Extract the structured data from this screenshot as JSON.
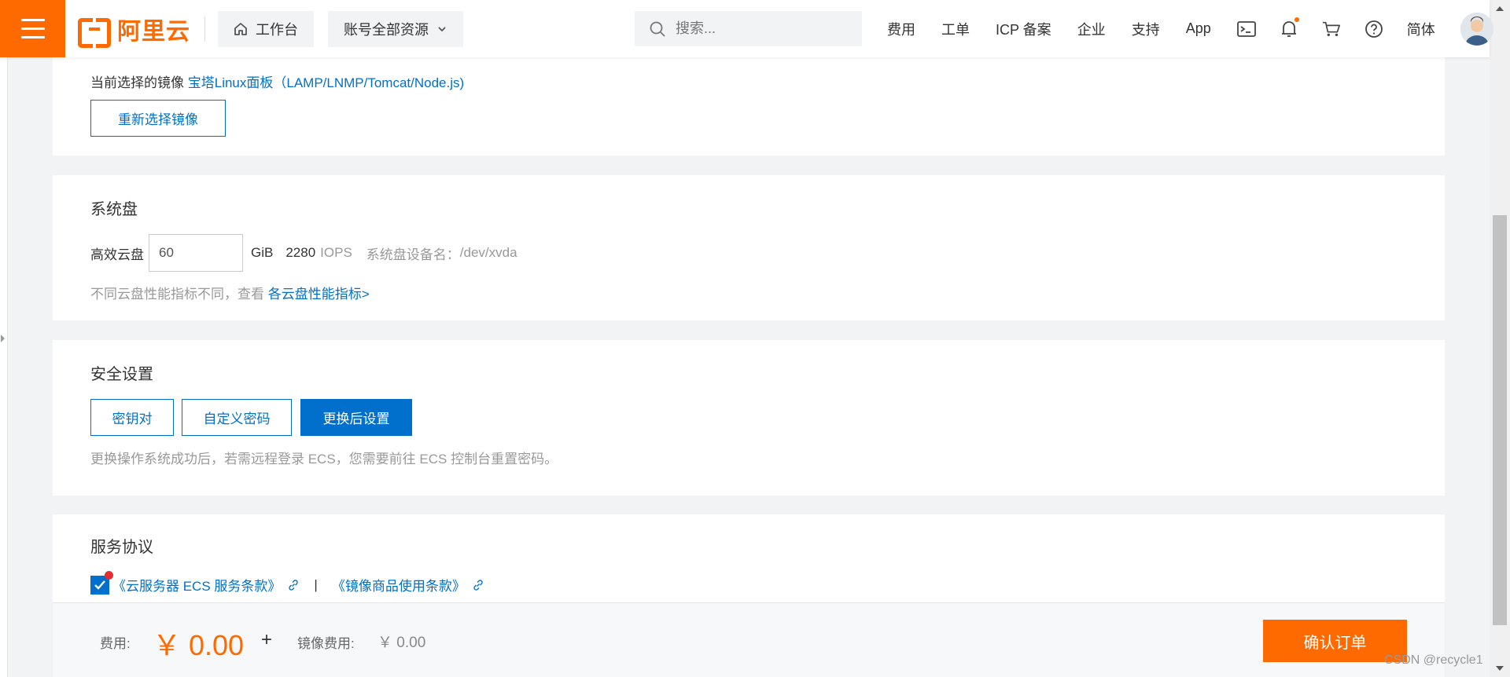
{
  "header": {
    "logo_text": "阿里云",
    "workbench_label": "工作台",
    "resources_label": "账号全部资源",
    "search_placeholder": "搜索...",
    "nav_links": [
      "费用",
      "工单",
      "ICP 备案",
      "企业",
      "支持",
      "App"
    ],
    "language_label": "简体"
  },
  "image_section": {
    "current_label": "当前选择的镜像",
    "current_image": "宝塔Linux面板（LAMP/LNMP/Tomcat/Node.js)",
    "reselect_button": "重新选择镜像"
  },
  "system_disk": {
    "title": "系统盘",
    "disk_type": "高效云盘",
    "size_value": "60",
    "unit": "GiB",
    "iops_value": "2280",
    "iops_label": "IOPS",
    "device_label": "系统盘设备名：",
    "device_name": "/dev/xvda",
    "note_prefix": "不同云盘性能指标不同，查看",
    "note_link": "各云盘性能指标>"
  },
  "security": {
    "title": "安全设置",
    "options": [
      "密钥对",
      "自定义密码",
      "更换后设置"
    ],
    "selected_index": 2,
    "note": "更换操作系统成功后，若需远程登录 ECS，您需要前往 ECS 控制台重置密码。"
  },
  "agreement": {
    "title": "服务协议",
    "checked": true,
    "link1": "《云服务器 ECS 服务条款》",
    "separator": "|",
    "link2": "《镜像商品使用条款》"
  },
  "footer": {
    "fee_label": "费用:",
    "fee_amount": "￥ 0.00",
    "plus": "+",
    "image_fee_label": "镜像费用:",
    "image_fee_amount": "￥ 0.00",
    "confirm_button": "确认订单"
  },
  "watermark": "CSDN @recycle1",
  "colors": {
    "brand_orange": "#ff6a00",
    "link_blue": "#0070cc",
    "page_bg": "#f2f3f5"
  }
}
